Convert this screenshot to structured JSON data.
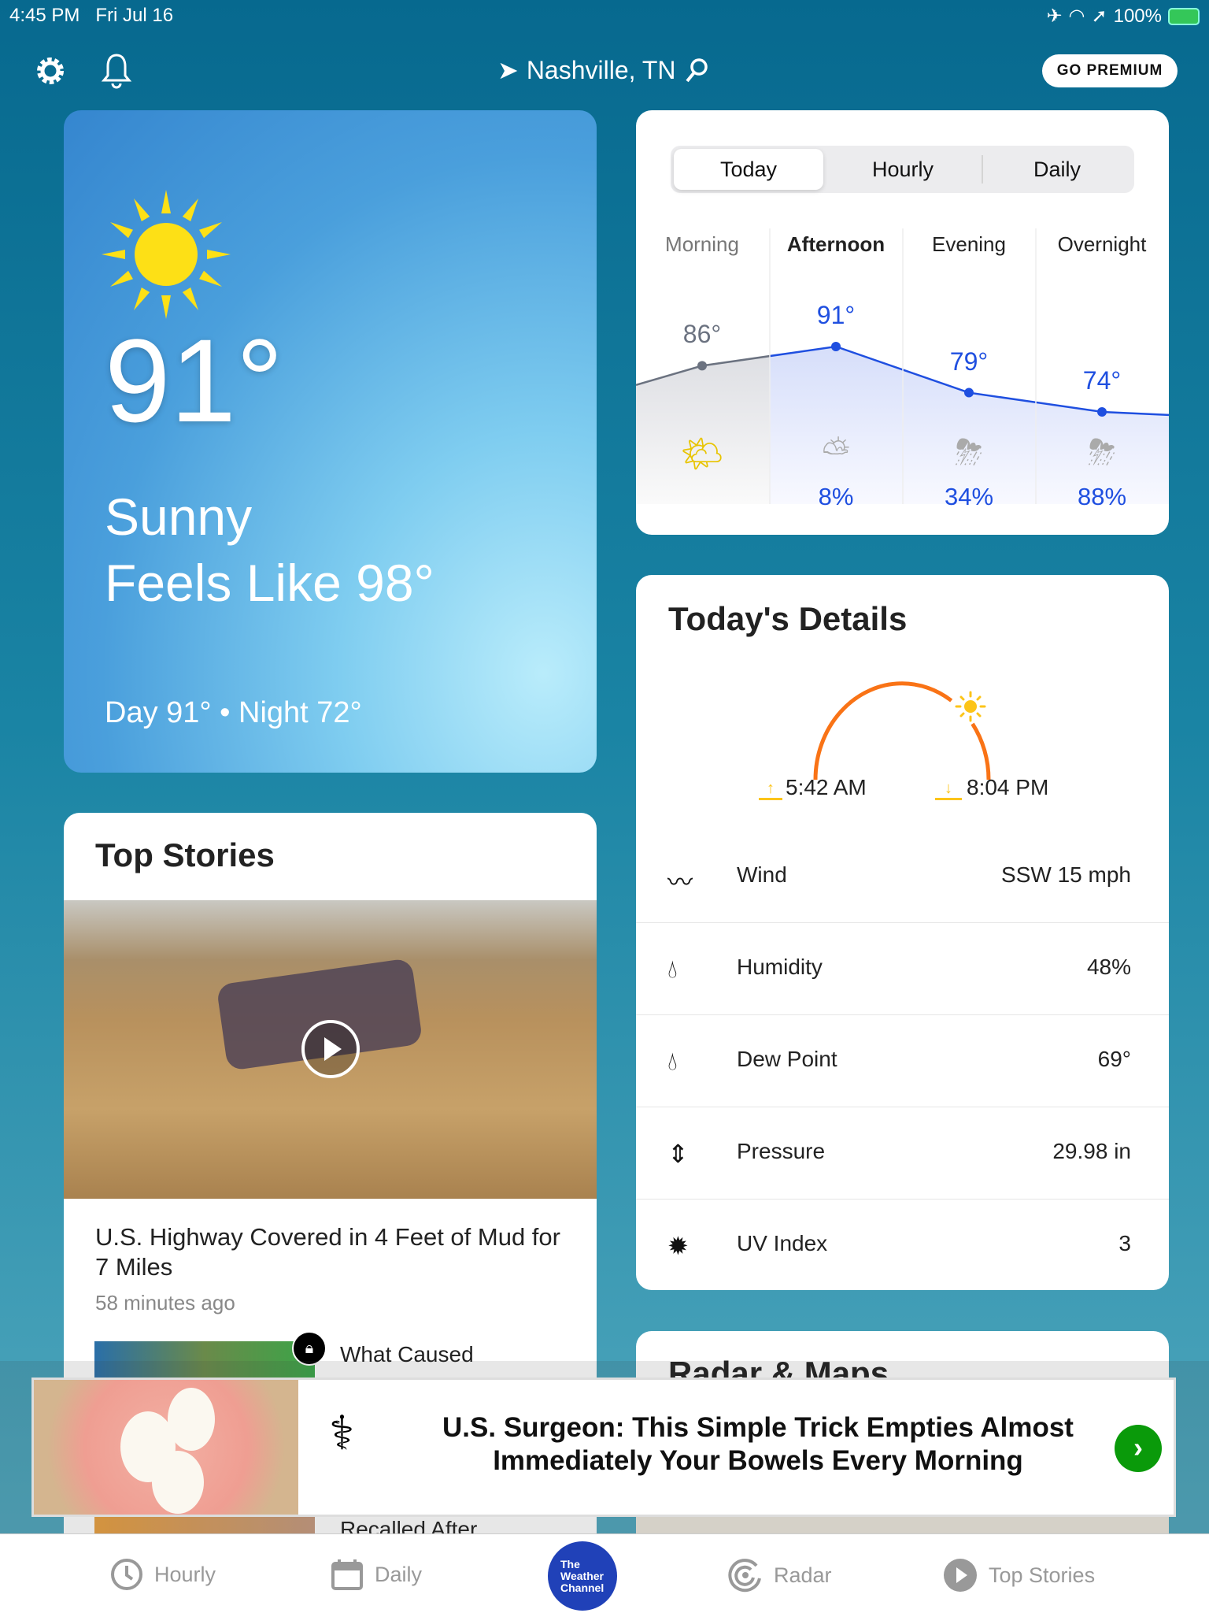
{
  "status_bar": {
    "time": "4:45 PM",
    "date": "Fri Jul 16",
    "battery": "100%"
  },
  "header": {
    "location": "Nashville, TN",
    "premium_label": "GO PREMIUM"
  },
  "current": {
    "temp": "91°",
    "condition": "Sunny",
    "feels_like": "Feels Like 98°",
    "day_night": "Day 91° • Night 72°"
  },
  "forecast": {
    "tabs": [
      "Today",
      "Hourly",
      "Daily"
    ],
    "selected_tab": "Today",
    "periods": [
      {
        "label": "Morning",
        "temp": "86°",
        "temp_value": 86,
        "icon": "sunny-partly-cloudy-icon",
        "precip": ""
      },
      {
        "label": "Afternoon",
        "temp": "91°",
        "temp_value": 91,
        "icon": "partly-cloudy-icon",
        "precip": "8%"
      },
      {
        "label": "Evening",
        "temp": "79°",
        "temp_value": 79,
        "icon": "night-thunderstorm-icon",
        "precip": "34%"
      },
      {
        "label": "Overnight",
        "temp": "74°",
        "temp_value": 74,
        "icon": "thunderstorm-icon",
        "precip": "88%"
      }
    ],
    "line_color": "#1f4fe0"
  },
  "details": {
    "title": "Today's Details",
    "sunrise": "5:42 AM",
    "sunset": "8:04 PM",
    "rows": [
      {
        "icon": "wind-icon",
        "label": "Wind",
        "value": "SSW 15 mph"
      },
      {
        "icon": "humidity-icon",
        "label": "Humidity",
        "value": "48%"
      },
      {
        "icon": "dew-point-icon",
        "label": "Dew Point",
        "value": "69°"
      },
      {
        "icon": "pressure-icon",
        "label": "Pressure",
        "value": "29.98 in"
      },
      {
        "icon": "uv-index-icon",
        "label": "UV Index",
        "value": "3"
      }
    ]
  },
  "top_stories": {
    "title": "Top Stories",
    "headline": "U.S. Highway Covered in 4 Feet of Mud for 7 Miles",
    "time": "58 minutes ago",
    "story2": "What Caused",
    "story3": "Recalled After"
  },
  "radar": {
    "title": "Radar & Maps"
  },
  "ad": {
    "text": "U.S. Surgeon: This Simple Trick Empties Almost Immediately Your Bowels Every Morning"
  },
  "nav": {
    "items": [
      "Hourly",
      "Daily",
      "Radar",
      "Top Stories"
    ],
    "logo": "The Weather Channel"
  }
}
